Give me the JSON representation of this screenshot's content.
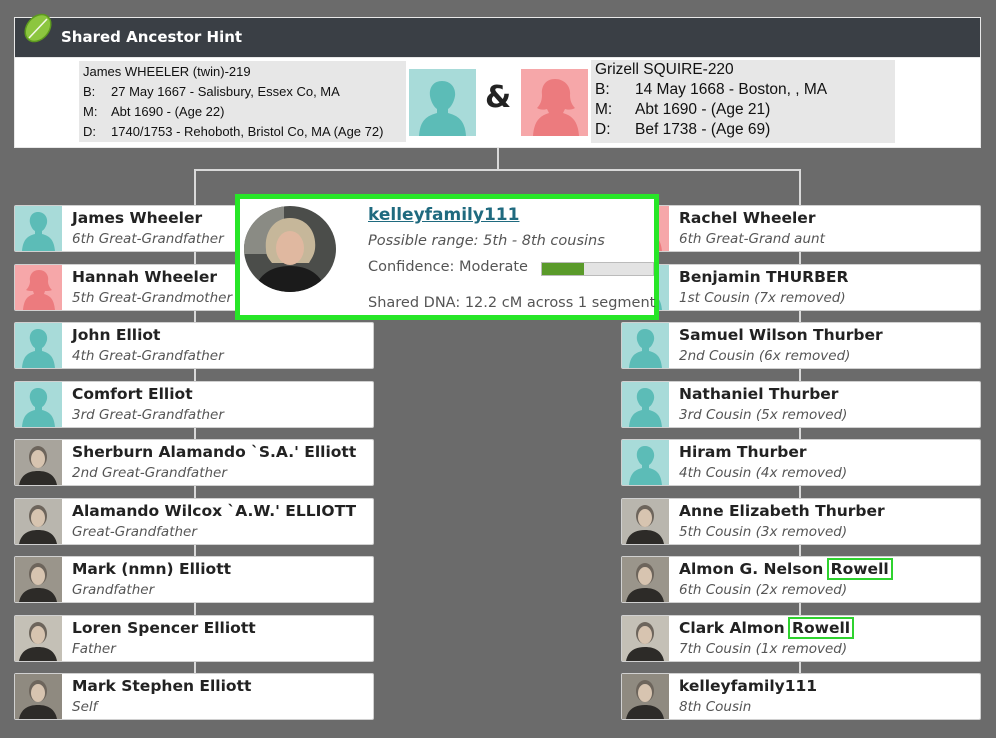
{
  "header": {
    "title": "Shared Ancestor Hint",
    "icon": "leaf-icon"
  },
  "couple": {
    "left": {
      "name": "James WHEELER (twin)-219",
      "rows": [
        {
          "label": "B:",
          "value": "27 May 1667 - Salisbury, Essex Co, MA"
        },
        {
          "label": "M:",
          "value": "Abt 1690 - (Age 22)"
        },
        {
          "label": "D:",
          "value": "1740/1753 - Rehoboth, Bristol Co, MA (Age 72)"
        }
      ]
    },
    "ampersand": "&",
    "right": {
      "name": "Grizell SQUIRE-220",
      "rows": [
        {
          "label": "B:",
          "value": "14 May 1668 - Boston, , MA"
        },
        {
          "label": "M:",
          "value": "Abt 1690 - (Age 21)"
        },
        {
          "label": "D:",
          "value": "Bef 1738 - (Age 69)"
        }
      ]
    }
  },
  "left_line": [
    {
      "name": "James Wheeler",
      "relation": "6th Great-Grandfather",
      "avatar": "male-silhouette"
    },
    {
      "name": "Hannah Wheeler",
      "relation": "5th Great-Grandmother",
      "avatar": "female-silhouette"
    },
    {
      "name": "John Elliot",
      "relation": "4th Great-Grandfather",
      "avatar": "male-silhouette"
    },
    {
      "name": "Comfort Elliot",
      "relation": "3rd Great-Grandfather",
      "avatar": "male-silhouette"
    },
    {
      "name": "Sherburn Alamando `S.A.' Elliott",
      "relation": "2nd Great-Grandfather",
      "avatar": "photo"
    },
    {
      "name": "Alamando Wilcox `A.W.' ELLIOTT",
      "relation": "Great-Grandfather",
      "avatar": "photo"
    },
    {
      "name": "Mark (nmn) Elliott",
      "relation": "Grandfather",
      "avatar": "photo"
    },
    {
      "name": "Loren Spencer Elliott",
      "relation": "Father",
      "avatar": "photo"
    },
    {
      "name": "Mark Stephen Elliott",
      "relation": "Self",
      "avatar": "photo"
    }
  ],
  "right_line": [
    {
      "name": "Rachel Wheeler",
      "name_hl": "",
      "relation": "6th Great-Grand aunt",
      "avatar": "female-silhouette"
    },
    {
      "name": "Benjamin THURBER",
      "name_hl": "",
      "relation": "1st Cousin (7x removed)",
      "avatar": "male-silhouette"
    },
    {
      "name": "Samuel Wilson Thurber",
      "name_hl": "",
      "relation": "2nd Cousin (6x removed)",
      "avatar": "male-silhouette"
    },
    {
      "name": "Nathaniel Thurber",
      "name_hl": "",
      "relation": "3rd Cousin (5x removed)",
      "avatar": "male-silhouette"
    },
    {
      "name": "Hiram Thurber",
      "name_hl": "",
      "relation": "4th Cousin (4x removed)",
      "avatar": "male-silhouette"
    },
    {
      "name": "Anne Elizabeth Thurber",
      "name_hl": "",
      "relation": "5th Cousin (3x removed)",
      "avatar": "photo"
    },
    {
      "name": "Almon G. Nelson ",
      "name_hl": "Rowell",
      "relation": "6th Cousin (2x removed)",
      "avatar": "photo"
    },
    {
      "name": "Clark Almon ",
      "name_hl": "Rowell",
      "relation": "7th Cousin (1x removed)",
      "avatar": "photo"
    },
    {
      "name": "kelleyfamily111",
      "name_hl": "",
      "relation": "8th Cousin",
      "avatar": "photo"
    }
  ],
  "popup": {
    "username": "kelleyfamily111",
    "range": "Possible range: 5th - 8th cousins",
    "confidence": "Confidence: Moderate",
    "confidence_level": 0.38,
    "shared_dna": "Shared DNA: 12.2 cM across 1 segment"
  },
  "colors": {
    "male": "#a8dbd9",
    "male_fg": "#5cbcb7",
    "female": "#f6a7a9",
    "female_fg": "#ec7b7e",
    "highlight": "#2fd22f",
    "header_bg": "#3a3f45",
    "link": "#1f6a7f"
  }
}
